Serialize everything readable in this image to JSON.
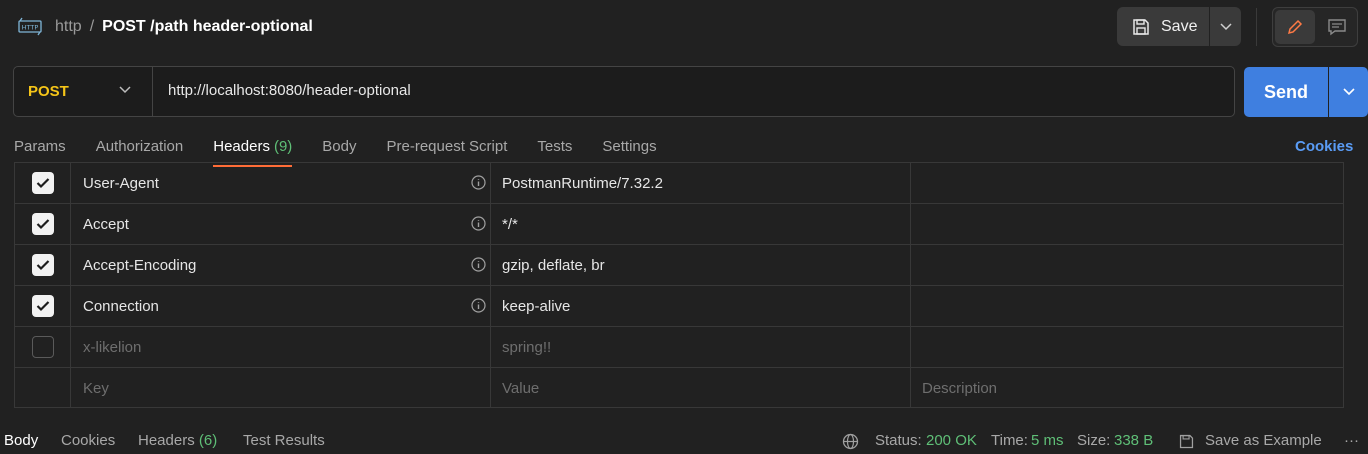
{
  "header": {
    "icon": "http-icon",
    "breadcrumb_parent": "http",
    "separator": "/",
    "title": "POST /path header-optional",
    "save_label": "Save"
  },
  "request": {
    "method": "POST",
    "url": "http://localhost:8080/header-optional",
    "send_label": "Send"
  },
  "tabs": [
    {
      "label": "Params",
      "count": ""
    },
    {
      "label": "Authorization",
      "count": ""
    },
    {
      "label": "Headers",
      "count": "(9)"
    },
    {
      "label": "Body",
      "count": ""
    },
    {
      "label": "Pre-request Script",
      "count": ""
    },
    {
      "label": "Tests",
      "count": ""
    },
    {
      "label": "Settings",
      "count": ""
    }
  ],
  "active_tab": "Headers",
  "cookies_label": "Cookies",
  "headers_table": {
    "rows": [
      {
        "checked": true,
        "key": "User-Agent",
        "value": "PostmanRuntime/7.32.2"
      },
      {
        "checked": true,
        "key": "Accept",
        "value": "*/*"
      },
      {
        "checked": true,
        "key": "Accept-Encoding",
        "value": "gzip, deflate, br"
      },
      {
        "checked": true,
        "key": "Connection",
        "value": "keep-alive"
      },
      {
        "checked": false,
        "key": "x-likelion",
        "value": "spring!!"
      }
    ],
    "placeholder": {
      "key": "Key",
      "value": "Value",
      "description": "Description"
    }
  },
  "response_tabs": [
    {
      "label": "Body",
      "count": ""
    },
    {
      "label": "Cookies",
      "count": ""
    },
    {
      "label": "Headers",
      "count": "(6)"
    },
    {
      "label": "Test Results",
      "count": ""
    }
  ],
  "response_status": {
    "status_label": "Status:",
    "status_value": "200 OK",
    "time_label": "Time:",
    "time_value": "5 ms",
    "size_label": "Size:",
    "size_value": "338 B",
    "save_example": "Save as Example",
    "more": "···"
  },
  "colors": {
    "accent_orange": "#ff6c37",
    "send_blue": "#3f7fe0",
    "method_yellow": "#f5c518",
    "count_green": "#5fbf77",
    "link_blue": "#5a9cf5"
  }
}
